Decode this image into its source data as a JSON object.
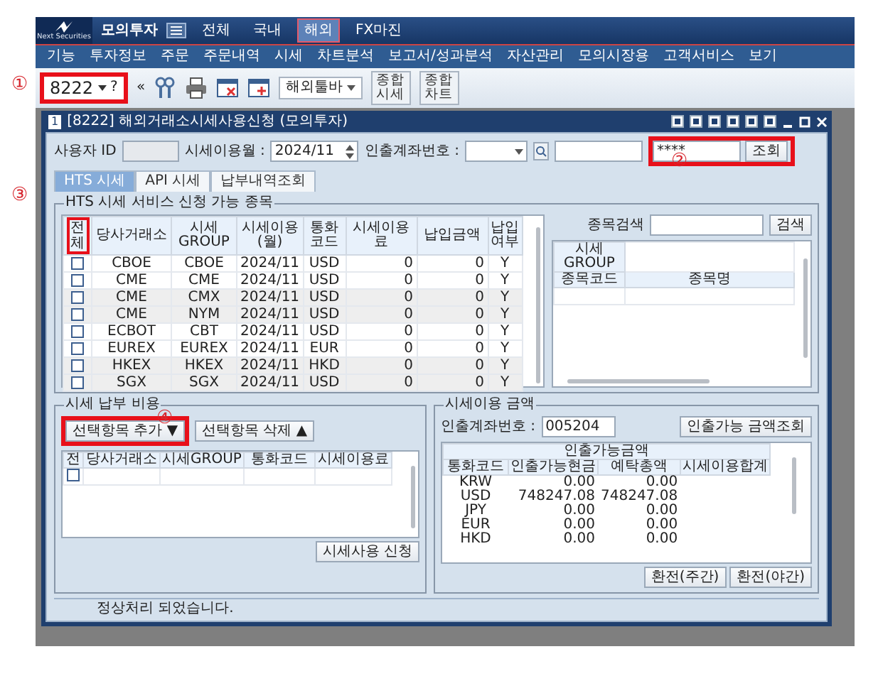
{
  "app": {
    "brand": "Next Securities",
    "mode": "모의투자",
    "top_tabs": [
      {
        "label": "전체",
        "selected": false
      },
      {
        "label": "국내",
        "selected": false
      },
      {
        "label": "해외",
        "selected": true
      },
      {
        "label": "FX마진",
        "selected": false
      }
    ],
    "menu": [
      "기능",
      "투자정보",
      "주문",
      "주문내역",
      "시세",
      "차트분석",
      "보고서/성과분석",
      "자산관리",
      "모의시장용",
      "고객서비스",
      "보기"
    ]
  },
  "toolbar": {
    "annotation": "①",
    "screen_number": "8222",
    "help": "?",
    "collapse": "«",
    "dropdown": "해외툴바",
    "buttons": [
      {
        "lines": [
          "종합",
          "시세"
        ]
      },
      {
        "lines": [
          "종합",
          "차트"
        ]
      }
    ]
  },
  "window": {
    "number": "1",
    "title": "[8222] 해외거래소시세사용신청 (모의투자)"
  },
  "form": {
    "user_id_label": "사용자 ID",
    "month_label": "시세이용월 :",
    "month_value": "2024/11",
    "account_label": "인출계좌번호 :",
    "password_value": "****",
    "query_button": "조회",
    "annotation": "②"
  },
  "tabs": [
    {
      "label": "HTS 시세",
      "selected": true
    },
    {
      "label": "API 시세",
      "selected": false
    },
    {
      "label": "납부내역조회",
      "selected": false
    }
  ],
  "available": {
    "legend": "HTS 시세 서비스 신청 가능 종목",
    "annotation": "③",
    "check_header": "전체",
    "columns": [
      "당사거래소",
      "시세GROUP",
      "시세이용(월)",
      "통화코드",
      "시세이용료",
      "납입금액",
      "납입여부"
    ],
    "rows": [
      {
        "checked": false,
        "cells": [
          "CBOE",
          "CBOE",
          "2024/11",
          "USD",
          "0",
          "0",
          "Y"
        ]
      },
      {
        "checked": false,
        "cells": [
          "CME",
          "CME",
          "2024/11",
          "USD",
          "0",
          "0",
          "Y"
        ]
      },
      {
        "checked": false,
        "cells": [
          "CME",
          "CMX",
          "2024/11",
          "USD",
          "0",
          "0",
          "Y"
        ]
      },
      {
        "checked": false,
        "cells": [
          "CME",
          "NYM",
          "2024/11",
          "USD",
          "0",
          "0",
          "Y"
        ]
      },
      {
        "checked": false,
        "cells": [
          "ECBOT",
          "CBT",
          "2024/11",
          "USD",
          "0",
          "0",
          "Y"
        ]
      },
      {
        "checked": false,
        "cells": [
          "EUREX",
          "EUREX",
          "2024/11",
          "EUR",
          "0",
          "0",
          "Y"
        ]
      },
      {
        "checked": false,
        "cells": [
          "HKEX",
          "HKEX",
          "2024/11",
          "HKD",
          "0",
          "0",
          "Y"
        ]
      },
      {
        "checked": false,
        "cells": [
          "SGX",
          "SGX",
          "2024/11",
          "USD",
          "0",
          "0",
          "Y"
        ]
      }
    ],
    "search_label": "종목검색",
    "search_button": "검색",
    "group_label": "시세GROUP",
    "code_column": "종목코드",
    "name_column": "종목명"
  },
  "payment": {
    "legend": "시세 납부 비용",
    "annotation": "④",
    "add_button": "선택항목 추가 ▼",
    "delete_button": "선택항목 삭제 ▲",
    "check_header": "전",
    "columns": [
      "당사거래소",
      "시세GROUP",
      "통화코드",
      "시세이용료"
    ],
    "rows": [
      {
        "checked": false
      }
    ],
    "apply_button": "시세사용 신청"
  },
  "amount": {
    "legend": "시세이용 금액",
    "account_label": "인출계좌번호 :",
    "account_value": "005204",
    "query_button": "인출가능 금액조회",
    "group_header": "인출가능금액",
    "columns": [
      "통화코드",
      "인출가능현금",
      "예탁총액",
      "시세이용합계"
    ],
    "rows": [
      [
        "KRW",
        "0.00",
        "0.00",
        ""
      ],
      [
        "USD",
        "748247.08",
        "748247.08",
        ""
      ],
      [
        "JPY",
        "0.00",
        "0.00",
        ""
      ],
      [
        "EUR",
        "0.00",
        "0.00",
        ""
      ],
      [
        "HKD",
        "0.00",
        "0.00",
        ""
      ]
    ],
    "buttons": [
      "환전(주간)",
      "환전(야간)"
    ]
  },
  "status_bar": "정상처리 되었습니다."
}
